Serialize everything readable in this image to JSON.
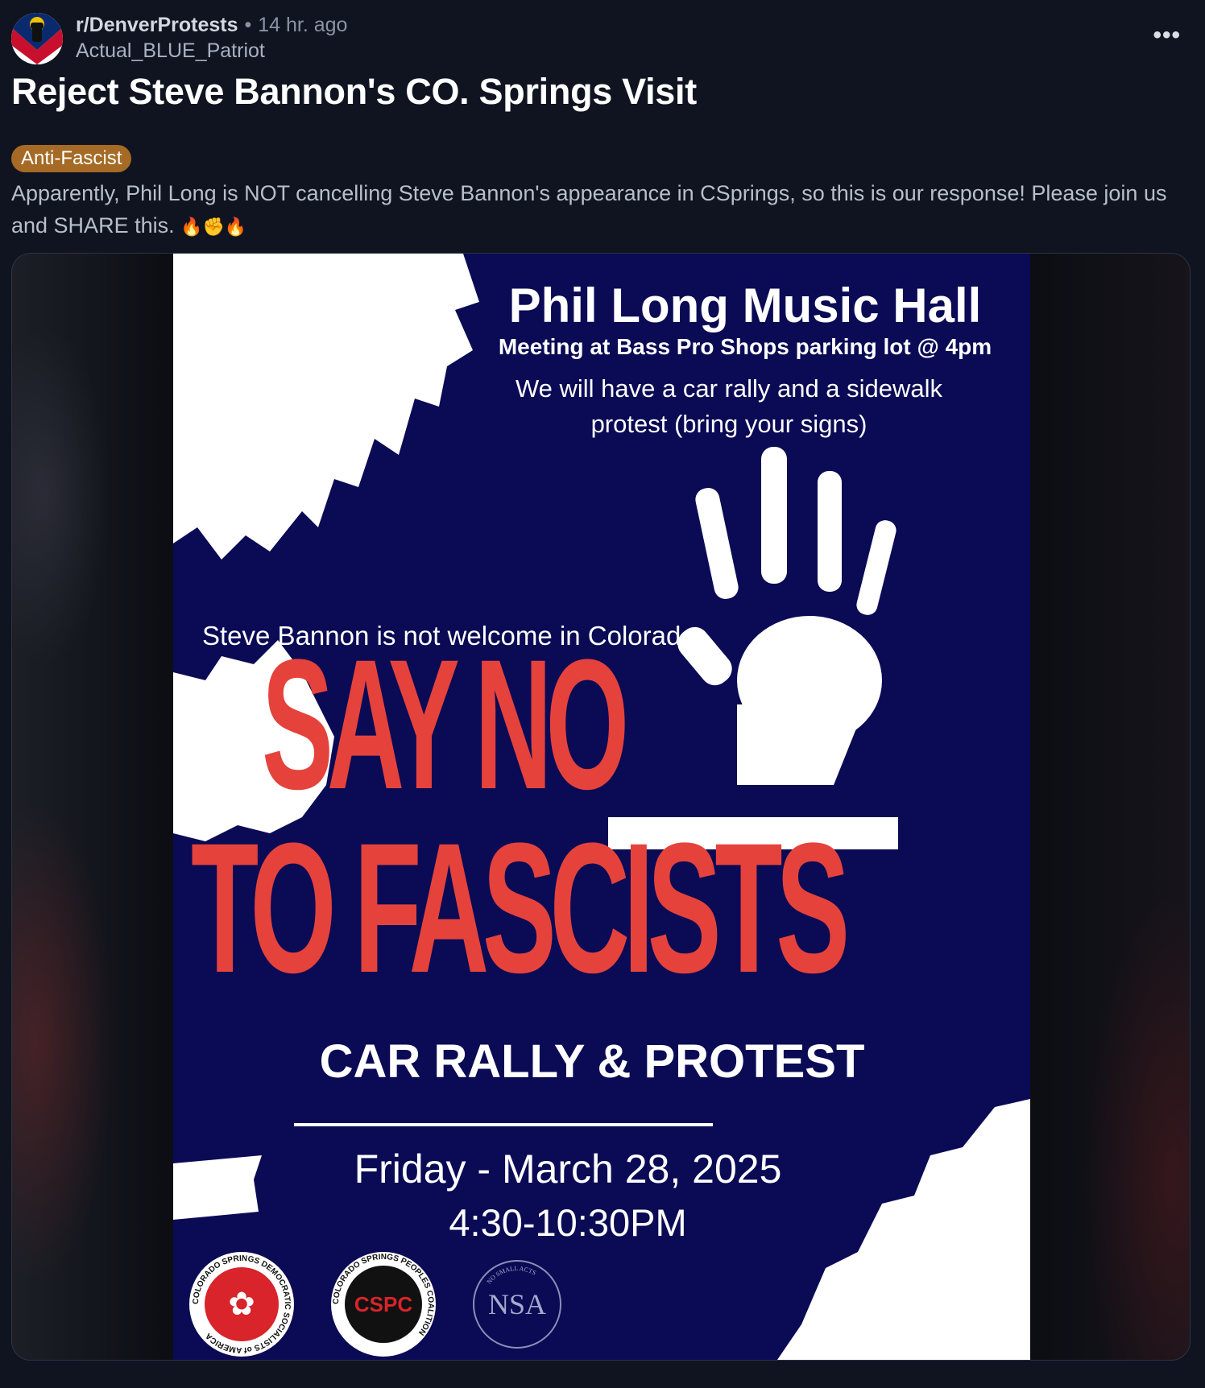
{
  "post": {
    "subreddit": "r/DenverProtests",
    "separator": "•",
    "time_ago": "14 hr. ago",
    "author": "Actual_BLUE_Patriot",
    "more_label": "•••",
    "title": "Reject Steve Bannon's CO. Springs Visit",
    "flair": "Anti-Fascist",
    "body": "Apparently, Phil Long is NOT cancelling Steve Bannon's appearance in CSprings, so this is our response! Please join us and SHARE this.",
    "emojis": "🔥✊🔥"
  },
  "poster": {
    "venue": "Phil Long Music Hall",
    "meeting": "Meeting at Bass Pro Shops parking lot @ 4pm",
    "plan": "We will have a car rally and a sidewalk protest (bring your signs)",
    "welcome": "Steve Bannon is not welcome in Colorado",
    "headline_1": "SAY NO",
    "headline_2": "TO FASCISTS",
    "event_type": "CAR RALLY & PROTEST",
    "date": "Friday - March 28, 2025",
    "time": "4:30-10:30PM",
    "logos": {
      "dsa_ring": "COLORADO SPRINGS DEMOCRATIC SOCIALISTS of AMERICA",
      "cspc_ring": "COLORADO SPRINGS PEOPLES COALITION",
      "cspc_inner": "CSPC",
      "nsa_ring": "NO SMALL ACTS",
      "nsa_inner": "NSA"
    }
  },
  "colors": {
    "background": "#0f1420",
    "flair": "#a56a25",
    "poster_navy": "#0a0a55",
    "poster_red": "#e5423c"
  }
}
